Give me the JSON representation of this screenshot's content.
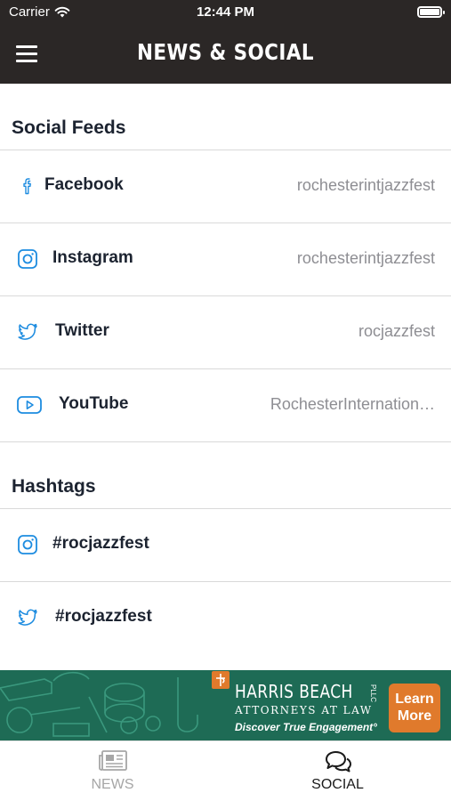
{
  "status_bar": {
    "carrier": "Carrier",
    "time": "12:44 PM",
    "icons": [
      "wifi-icon",
      "battery-icon"
    ]
  },
  "nav": {
    "title": "NEWS & SOCIAL",
    "menu_icon": "hamburger-menu-icon"
  },
  "social_feeds": {
    "heading": "Social Feeds",
    "items": [
      {
        "name": "Facebook",
        "handle": "rochesterintjazzfest",
        "icon": "facebook-icon"
      },
      {
        "name": "Instagram",
        "handle": "rochesterintjazzfest",
        "icon": "instagram-icon"
      },
      {
        "name": "Twitter",
        "handle": "rocjazzfest",
        "icon": "twitter-icon"
      },
      {
        "name": "YouTube",
        "handle": "RochesterInternation…",
        "icon": "youtube-icon"
      }
    ]
  },
  "hashtags": {
    "heading": "Hashtags",
    "items": [
      {
        "tag": "#rocjazzfest",
        "icon": "instagram-icon"
      },
      {
        "tag": "#rocjazzfest",
        "icon": "twitter-icon"
      }
    ]
  },
  "ad": {
    "brand": "HARRIS BEACH",
    "brand_suffix": "PLLC",
    "subtitle": "ATTORNEYS AT LAW",
    "tagline": "Discover True Engagement°",
    "cta_line1": "Learn",
    "cta_line2": "More",
    "background_color": "#1e6b55",
    "cta_color": "#e07a2c"
  },
  "tabbar": {
    "tabs": [
      {
        "label": "NEWS",
        "icon": "newspaper-icon",
        "active": false
      },
      {
        "label": "SOCIAL",
        "icon": "chat-bubbles-icon",
        "active": true
      }
    ]
  },
  "colors": {
    "header_bg": "#2b2726",
    "icon_blue": "#1d8ce0",
    "handle_gray": "#8e8e93"
  }
}
